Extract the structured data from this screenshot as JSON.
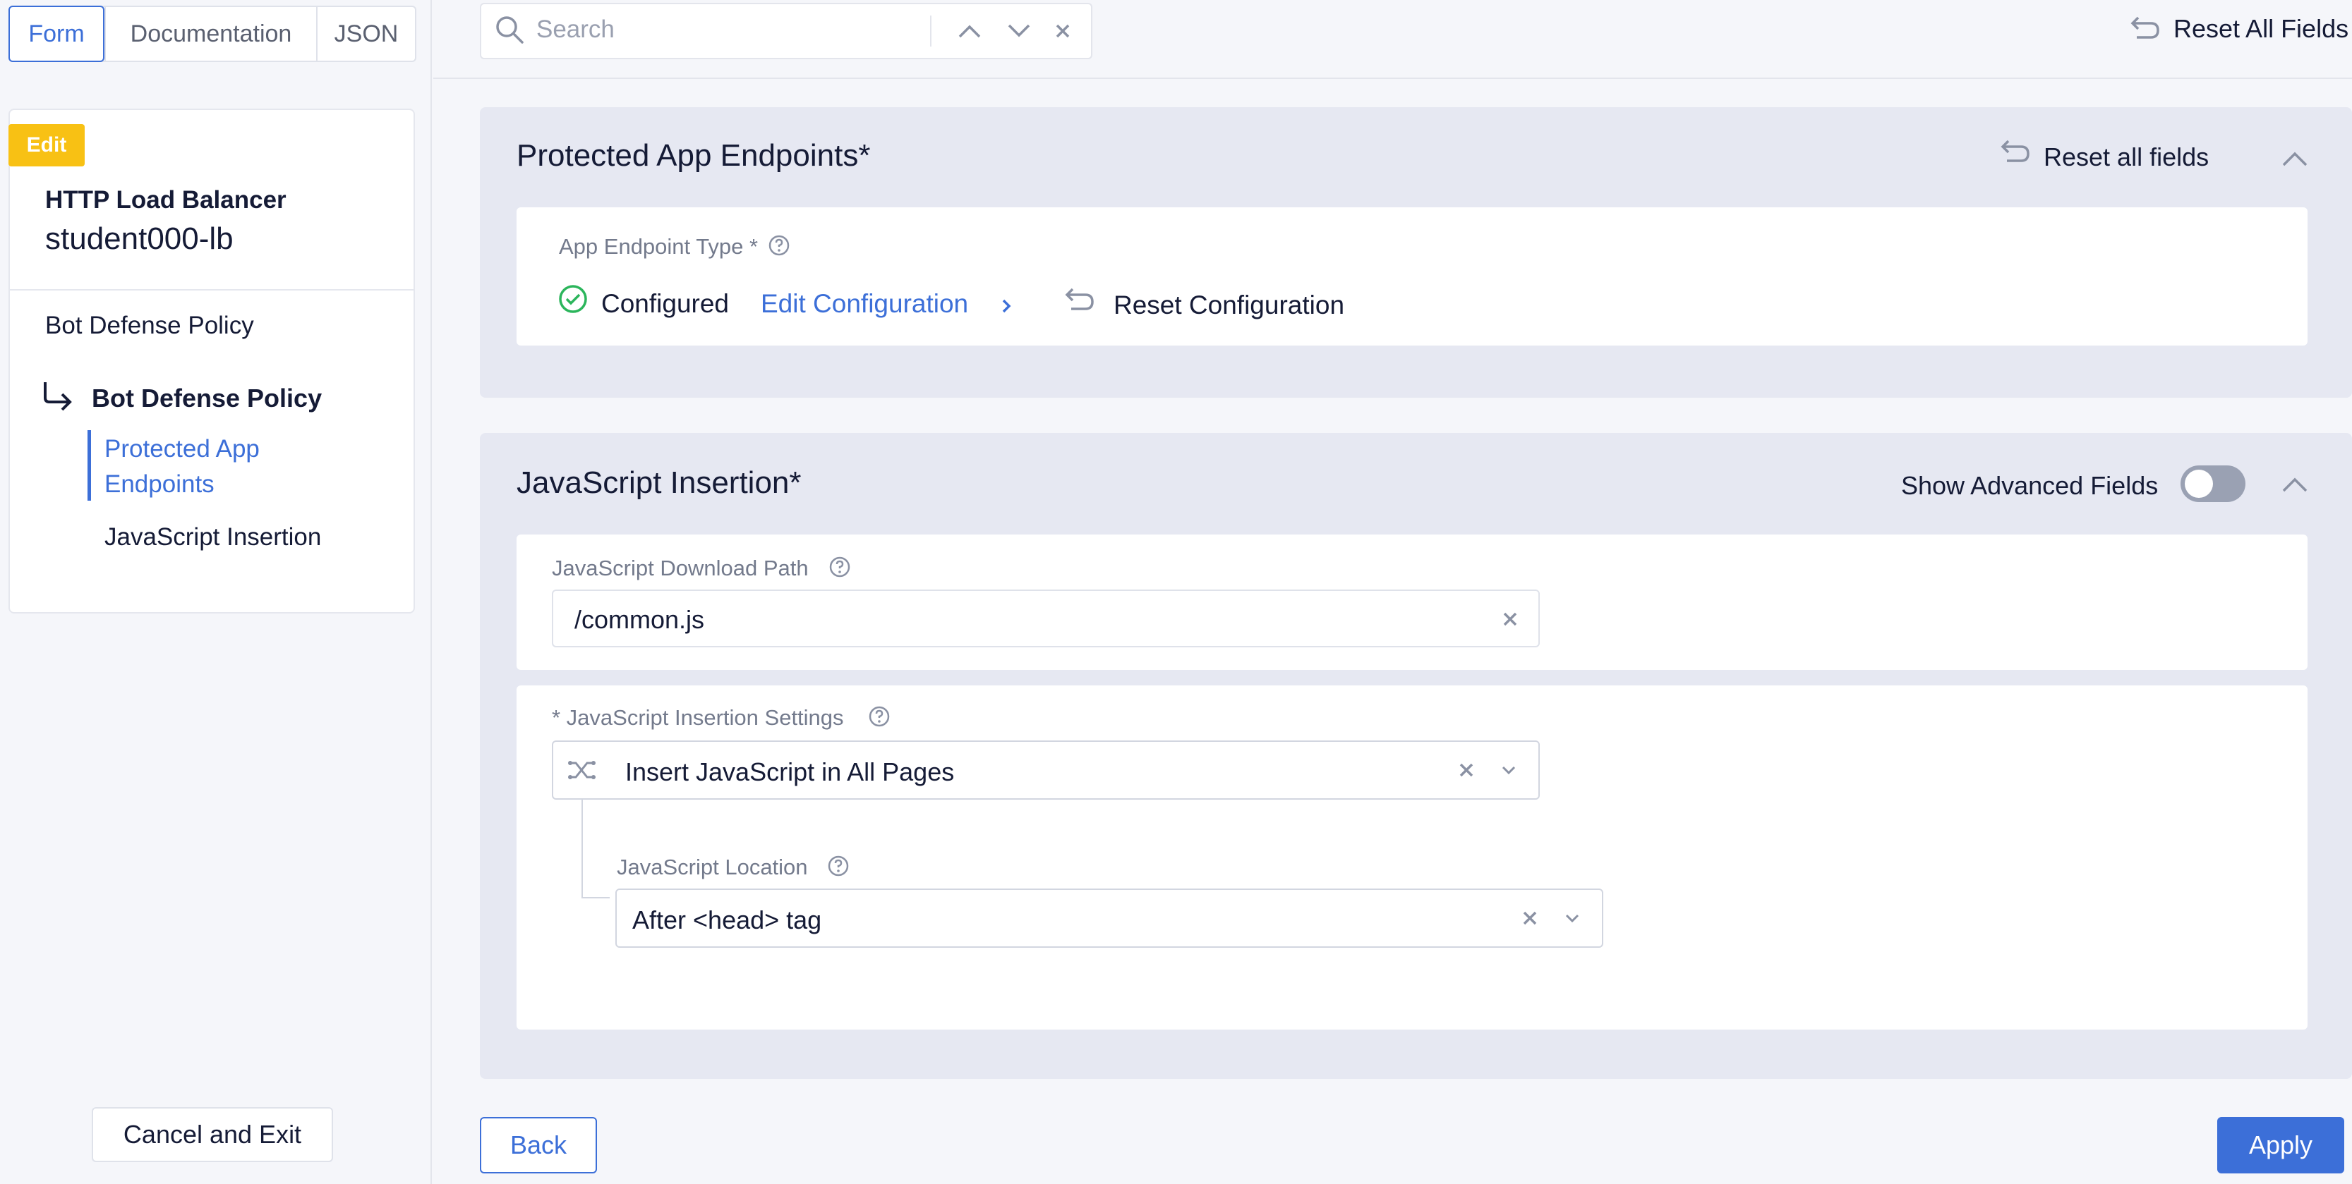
{
  "tabs": [
    {
      "label": "Form",
      "active": true
    },
    {
      "label": "Documentation",
      "active": false
    },
    {
      "label": "JSON",
      "active": false
    }
  ],
  "sidebar": {
    "badge": "Edit",
    "object_type": "HTTP Load Balancer",
    "object_name": "student000-lb",
    "nav_top": "Bot Defense Policy",
    "nav_current": "Bot Defense Policy",
    "nav_items": [
      {
        "label": "Protected App Endpoints",
        "active": true
      },
      {
        "label": "JavaScript Insertion",
        "active": false
      }
    ],
    "cancel_label": "Cancel and Exit"
  },
  "search": {
    "placeholder": "Search",
    "value": ""
  },
  "header": {
    "reset_all_label": "Reset All Fields"
  },
  "section1": {
    "title": "Protected App Endpoints",
    "required_mark": "*",
    "reset_label": "Reset all fields",
    "field_label": "App Endpoint Type *",
    "status": "Configured",
    "edit_label": "Edit Configuration",
    "reset_config_label": "Reset Configuration"
  },
  "section2": {
    "title": "JavaScript Insertion",
    "required_mark": "*",
    "advanced_label": "Show Advanced Fields",
    "advanced_on": false,
    "download_path": {
      "label": "JavaScript Download Path",
      "value": "/common.js"
    },
    "insertion_settings": {
      "label": "* JavaScript Insertion Settings",
      "value": "Insert JavaScript in All Pages"
    },
    "location": {
      "label": "JavaScript Location",
      "value": "After <head> tag"
    }
  },
  "footer": {
    "back_label": "Back",
    "apply_label": "Apply"
  },
  "colors": {
    "accent": "#3c6fd8",
    "badge": "#f8c114",
    "success": "#2bb55b",
    "section_bg": "#e6e8f2"
  }
}
